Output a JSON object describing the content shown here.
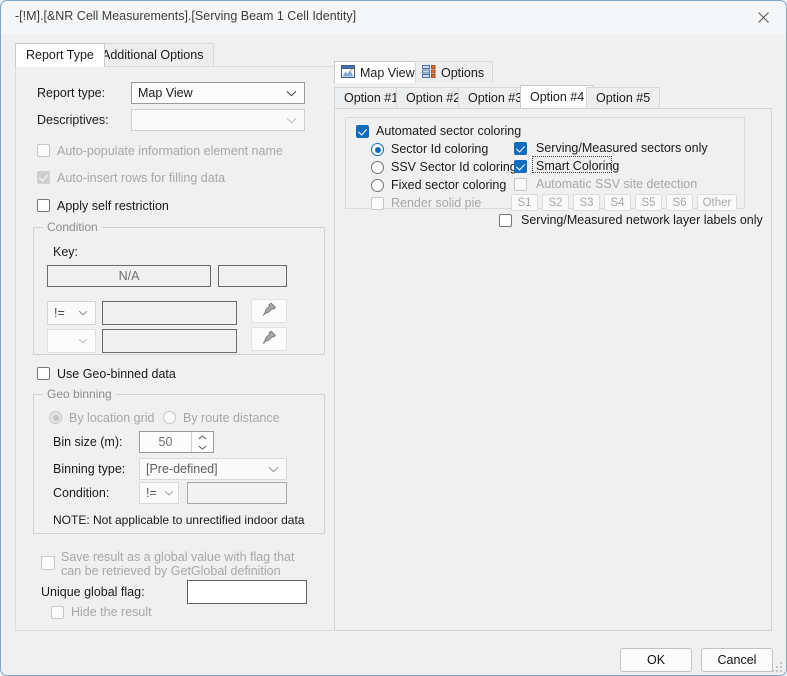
{
  "window": {
    "title": "-[!M].[&NR Cell Measurements].[Serving Beam 1 Cell Identity]",
    "close_label": "×"
  },
  "main_tabs": [
    {
      "label": "Report Type",
      "active": true
    },
    {
      "label": "Additional Options",
      "active": false
    }
  ],
  "report_type": {
    "report_type_label": "Report type:",
    "report_type_value": "Map View",
    "descriptives_label": "Descriptives:",
    "descriptives_value": "",
    "auto_populate_label": "Auto-populate information element name",
    "auto_insert_label": "Auto-insert rows for filling data",
    "apply_self_restriction_label": "Apply self restriction"
  },
  "condition": {
    "caption": "Condition",
    "key_label": "Key:",
    "key_value": "N/A",
    "key_extra_value": "",
    "operator_1": "!=",
    "operator_2": "",
    "value_1": "",
    "value_2": "",
    "pick_icon": "pin-icon"
  },
  "geo": {
    "use_geo_binned_label": "Use Geo-binned data",
    "caption": "Geo binning",
    "by_location_grid_label": "By location grid",
    "by_route_distance_label": "By route distance",
    "bin_size_label": "Bin size (m):",
    "bin_size_value": "50",
    "binning_type_label": "Binning type:",
    "binning_type_value": "[Pre-defined]",
    "condition_label": "Condition:",
    "condition_operator": "!=",
    "condition_value": "",
    "note": "NOTE: Not applicable to unrectified indoor data"
  },
  "global": {
    "save_result_line1": "Save result as a global value with flag that",
    "save_result_line2": "can be retrieved by GetGlobal definition",
    "unique_global_flag_label": "Unique global flag:",
    "unique_global_flag_value": "",
    "hide_result_label": "Hide the result"
  },
  "view_tabs": [
    {
      "label": "Map View",
      "icon": "map-view-icon",
      "active": true
    },
    {
      "label": "Options",
      "icon": "options-list-icon",
      "active": false
    }
  ],
  "option_tabs": [
    {
      "label": "Option #1",
      "active": false
    },
    {
      "label": "Option #2",
      "active": false
    },
    {
      "label": "Option #3",
      "active": false
    },
    {
      "label": "Option #4",
      "active": true
    },
    {
      "label": "Option #5",
      "active": false
    }
  ],
  "option4": {
    "automated_sector_coloring_label": "Automated sector coloring",
    "sector_id_coloring_label": "Sector Id coloring",
    "ssv_sector_id_coloring_label": "SSV Sector Id coloring",
    "fixed_sector_coloring_label": "Fixed sector coloring",
    "render_solid_pie_label": "Render solid pie",
    "serving_measured_sectors_label": "Serving/Measured sectors only",
    "smart_coloring_label": "Smart Coloring",
    "automatic_ssv_site_detection_label": "Automatic SSV site detection",
    "sector_buttons": [
      "S1",
      "S2",
      "S3",
      "S4",
      "S5",
      "S6",
      "Other"
    ],
    "network_layer_labels_label": "Serving/Measured network layer labels only"
  },
  "footer": {
    "ok_label": "OK",
    "cancel_label": "Cancel"
  },
  "colors": {
    "accent": "#0f6cbd",
    "dialog_bg": "#f0f0f0",
    "border": "#7ea5c9",
    "disabled_text": "#a7a7a7"
  }
}
